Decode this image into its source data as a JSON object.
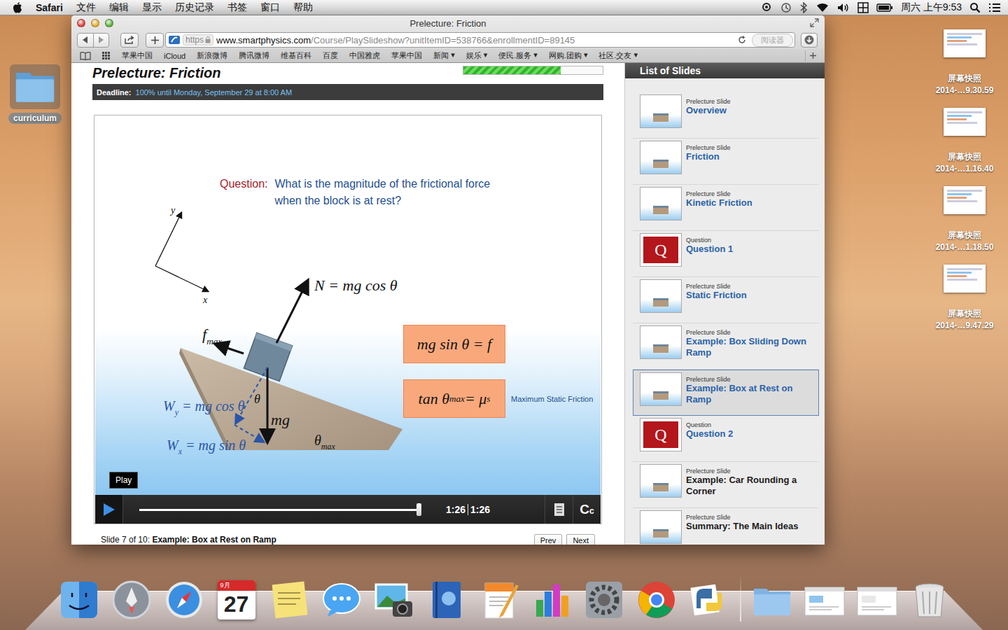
{
  "menubar": {
    "app": "Safari",
    "menus": [
      "文件",
      "编辑",
      "显示",
      "历史记录",
      "书签",
      "窗口",
      "帮助"
    ],
    "clock": "周六 上午9:53"
  },
  "desktop": {
    "folder": {
      "label": "curriculum",
      "selected": true
    },
    "files": [
      {
        "name": "屏幕快照",
        "date": "2014-…9.30.59"
      },
      {
        "name": "屏幕快照",
        "date": "2014-…1.16.40"
      },
      {
        "name": "屏幕快照",
        "date": "2014-…1.18.50"
      },
      {
        "name": "屏幕快照",
        "date": "2014-…9.47.29"
      }
    ]
  },
  "window": {
    "title": "Prelecture: Friction",
    "address": {
      "scheme": "https",
      "host": "www.smartphysics.com",
      "path": "/Course/PlaySlideshow?unitItemID=538766&enrollmentID=89145"
    },
    "reader": "阅读器",
    "bookmarks": {
      "menu_arrow": "▾",
      "items": [
        {
          "label": "苹果中国",
          "menu": false
        },
        {
          "label": "iCloud",
          "menu": false
        },
        {
          "label": "新浪微博",
          "menu": false
        },
        {
          "label": "腾讯微博",
          "menu": false
        },
        {
          "label": "维基百科",
          "menu": false
        },
        {
          "label": "百度",
          "menu": false
        },
        {
          "label": "中国雅虎",
          "menu": false
        },
        {
          "label": "苹果中国",
          "menu": false
        },
        {
          "label": "新闻",
          "menu": true
        },
        {
          "label": "娱乐",
          "menu": true
        },
        {
          "label": "便民.服务",
          "menu": true
        },
        {
          "label": "网购.团购",
          "menu": true
        },
        {
          "label": "社区.交友",
          "menu": true
        }
      ]
    }
  },
  "page": {
    "heading": "Prelecture: Friction",
    "progress": {
      "level": 0.7
    },
    "deadline": {
      "label": "Deadline:",
      "text": "100% until Monday, September 29 at 8:00 AM"
    },
    "slide": {
      "question": {
        "label": "Question:",
        "lines": [
          "What is the magnitude of the frictional force",
          "when the block is at rest?"
        ]
      },
      "axes": [
        "y",
        "x"
      ],
      "labels": [
        {
          "parts": [
            {
              "text": "N = mg cos θ",
              "sub": false
            }
          ]
        },
        {
          "parts": [
            {
              "text": "f",
              "sub": false
            },
            {
              "text": "max",
              "sub": true
            }
          ]
        },
        {
          "parts": [
            {
              "text": "θ",
              "sub": false
            }
          ]
        },
        {
          "parts": [
            {
              "text": "mg",
              "sub": false
            }
          ]
        },
        {
          "parts": [
            {
              "text": "W",
              "sub": false
            },
            {
              "text": "y",
              "sub": true
            },
            {
              "text": " = mg cos θ",
              "sub": false
            }
          ]
        },
        {
          "parts": [
            {
              "text": "W",
              "sub": false
            },
            {
              "text": "x",
              "sub": true
            },
            {
              "text": " = mg sin θ",
              "sub": false
            }
          ]
        },
        {
          "parts": [
            {
              "text": "θ",
              "sub": false
            },
            {
              "text": "max",
              "sub": true
            }
          ]
        }
      ],
      "formulas": [
        {
          "parts": [
            {
              "text": "mg sin θ = f",
              "sub": false
            }
          ],
          "note": ""
        },
        {
          "parts": [
            {
              "text": "tan θ",
              "sub": false
            },
            {
              "text": "max",
              "sub": true
            },
            {
              "text": " = μ",
              "sub": false
            },
            {
              "text": "s",
              "sub": true
            }
          ],
          "note": "Maximum Static Friction"
        }
      ]
    },
    "player": {
      "tooltip": "Play",
      "level": 1,
      "elapsed": "1:26",
      "total": "1:26",
      "cc": "Cc"
    },
    "caption": {
      "prefix": "Slide 7 of 10:",
      "title": "Example: Box at Rest on Ramp"
    },
    "nav": [
      "Prev",
      "Next"
    ]
  },
  "slides_panel": {
    "title": "List of Slides",
    "items": [
      {
        "kind": "slide",
        "type": "Prelecture Slide",
        "title": "Overview",
        "badge": "",
        "visited": true,
        "selected": false
      },
      {
        "kind": "slide",
        "type": "Prelecture Slide",
        "title": "Friction",
        "badge": "",
        "visited": true,
        "selected": false
      },
      {
        "kind": "slide",
        "type": "Prelecture Slide",
        "title": "Kinetic Friction",
        "badge": "",
        "visited": true,
        "selected": false
      },
      {
        "kind": "question",
        "type": "Question",
        "title": "Question 1",
        "badge": "Q",
        "visited": true,
        "selected": false
      },
      {
        "kind": "slide",
        "type": "Prelecture Slide",
        "title": "Static Friction",
        "badge": "",
        "visited": true,
        "selected": false
      },
      {
        "kind": "slide",
        "type": "Prelecture Slide",
        "title": "Example: Box Sliding Down Ramp",
        "badge": "",
        "visited": true,
        "selected": false
      },
      {
        "kind": "slide",
        "type": "Prelecture Slide",
        "title": "Example: Box at Rest on Ramp",
        "badge": "",
        "visited": true,
        "selected": true
      },
      {
        "kind": "question",
        "type": "Question",
        "title": "Question 2",
        "badge": "Q",
        "visited": true,
        "selected": false
      },
      {
        "kind": "slide",
        "type": "Prelecture Slide",
        "title": "Example: Car Rounding a Corner",
        "badge": "",
        "visited": false,
        "selected": false
      },
      {
        "kind": "slide",
        "type": "Prelecture Slide",
        "title": "Summary: The Main Ideas",
        "badge": "",
        "visited": false,
        "selected": false
      }
    ]
  },
  "dock": {
    "calendar": {
      "month": "9月",
      "day": "27"
    }
  }
}
